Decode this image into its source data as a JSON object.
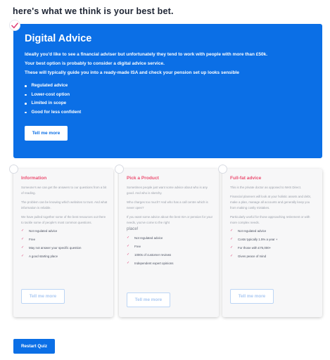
{
  "heading": "here's what we think is your best bet.",
  "colors": {
    "primary": "#0b6fe6",
    "accent": "#ec4f72",
    "tick": "#e0457a"
  },
  "hero": {
    "check_icon": "check-icon",
    "title": "Digital Advice",
    "paragraphs": [
      "Ideally you'd like to see a financial adviser but unfortunately they tend to work with people with more than £50k.",
      "Your best option is probably to consider a digital advice service.",
      "These will typically guide you into a ready-made ISA and check your pension set up looks sensible"
    ],
    "bullets": [
      "Regulated advice",
      "Lower-cost option",
      "Limited in scope",
      "Good for less confident"
    ],
    "button": "Tell me more"
  },
  "cards": [
    {
      "title": "Information",
      "paragraphs": [
        "Someone's we can get the answers to our questions from a bit of reading.",
        "The problem can be knowing which websites to trust. And what information is reliable.",
        "We have pulled together some of the best resources out there to tackle some of people's most common questions."
      ],
      "items": [
        "Not regulated advice",
        "Free",
        "May not answer your specific question",
        "A good starting place"
      ],
      "button": "Tell me more"
    },
    {
      "title": "Pick a Product",
      "paragraphs": [
        "Sometimes people just want some advice about who is any good. And who is sketchy.",
        "Who charges too much? And who has a call centre which is never open?",
        "If you want some advice about the best ISA or pension for your needs, you've come to the right"
      ],
      "extra": "place!",
      "items": [
        "Not regulated advice",
        "Free",
        "1000s of customer reviews",
        "Independent expert opinions"
      ],
      "button": "Tell me more"
    },
    {
      "title": "Full-fat advice",
      "paragraphs": [
        "This is the private doctor as opposed to NHS Direct.",
        "Financial planners will look at your holistic assets and debt, make a plan, manage all accounts and generally keep you from making costly mistakes.",
        "Particularly useful for those approaching retirement or with more complex needs."
      ],
      "items": [
        "Not regulated advice",
        "Costs typically 1.5% a year +",
        "For those with £75,000+",
        "Gives peace of mind"
      ],
      "button": "Tell me more"
    }
  ],
  "restart": "Restart Quiz"
}
